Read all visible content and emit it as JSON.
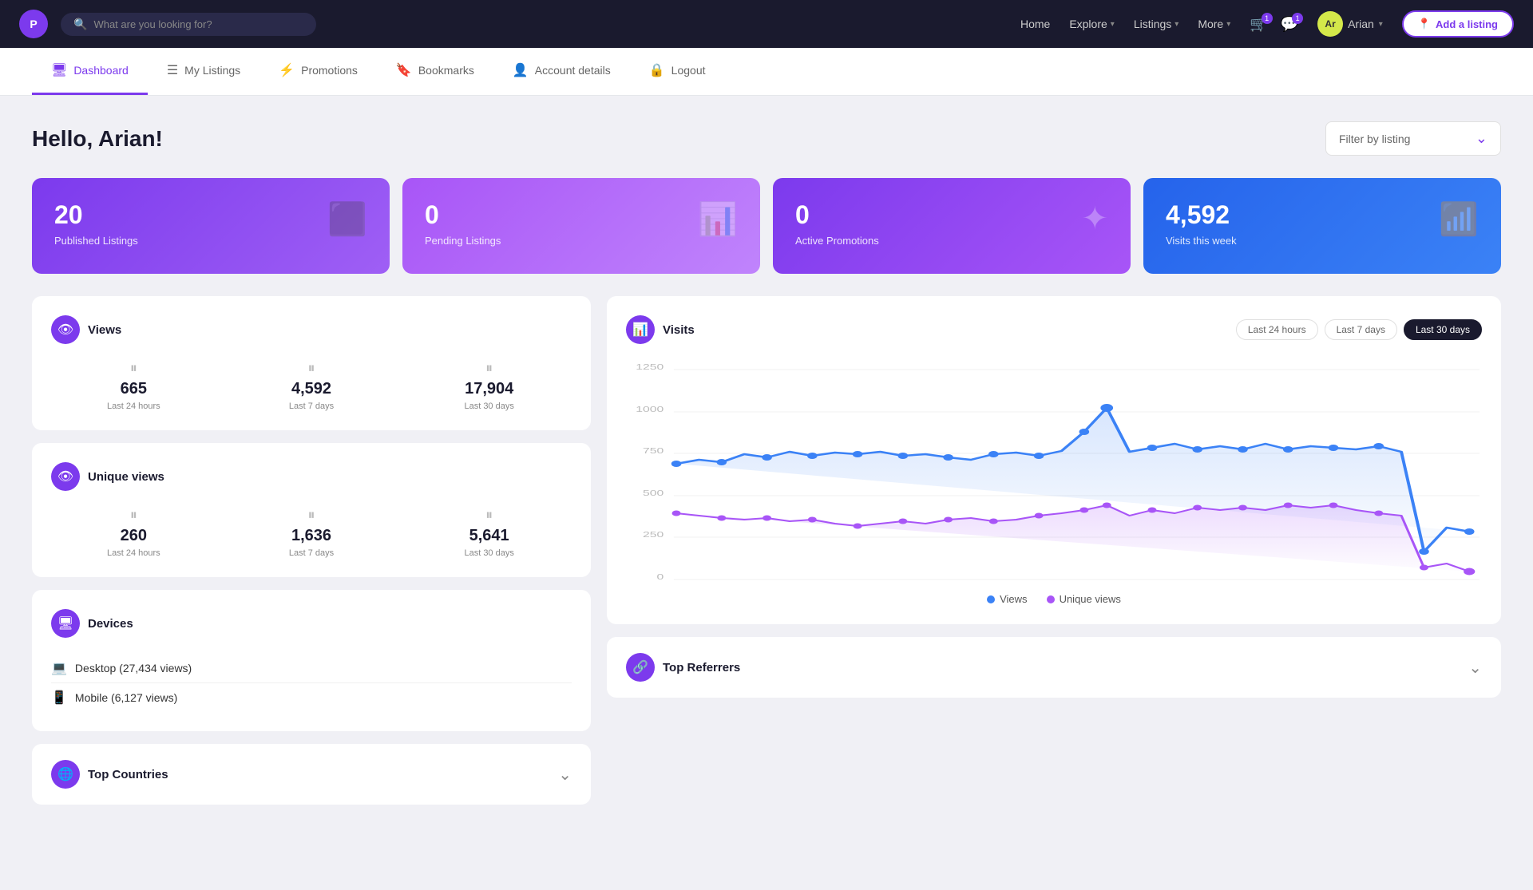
{
  "nav": {
    "logo": "P",
    "search_placeholder": "What are you looking for?",
    "links": [
      {
        "label": "Home",
        "has_dropdown": false
      },
      {
        "label": "Explore",
        "has_dropdown": true
      },
      {
        "label": "Listings",
        "has_dropdown": true
      },
      {
        "label": "More",
        "has_dropdown": true
      }
    ],
    "user": {
      "name": "Arian",
      "initials": "Ar"
    },
    "add_listing": "Add a listing"
  },
  "secondary_nav": {
    "items": [
      {
        "label": "Dashboard",
        "icon": "🖥",
        "active": true
      },
      {
        "label": "My Listings",
        "icon": "≡",
        "active": false
      },
      {
        "label": "Promotions",
        "icon": "⚡",
        "active": false
      },
      {
        "label": "Bookmarks",
        "icon": "🔖",
        "active": false
      },
      {
        "label": "Account details",
        "icon": "👤",
        "active": false
      },
      {
        "label": "Logout",
        "icon": "🔒",
        "active": false
      }
    ]
  },
  "page": {
    "greeting": "Hello, Arian!",
    "filter_label": "Filter by listing"
  },
  "stat_cards": [
    {
      "number": "20",
      "label": "Published Listings"
    },
    {
      "number": "0",
      "label": "Pending Listings"
    },
    {
      "number": "0",
      "label": "Active Promotions"
    },
    {
      "number": "4,592",
      "label": "Visits this week"
    }
  ],
  "views_panel": {
    "title": "Views",
    "stats": [
      {
        "value": "665",
        "label": "Last 24 hours"
      },
      {
        "value": "4,592",
        "label": "Last 7 days"
      },
      {
        "value": "17,904",
        "label": "Last 30 days"
      }
    ]
  },
  "unique_views_panel": {
    "title": "Unique views",
    "stats": [
      {
        "value": "260",
        "label": "Last 24 hours"
      },
      {
        "value": "1,636",
        "label": "Last 7 days"
      },
      {
        "value": "5,641",
        "label": "Last 30 days"
      }
    ]
  },
  "devices_panel": {
    "title": "Devices",
    "items": [
      {
        "icon": "💻",
        "label": "Desktop (27,434 views)"
      },
      {
        "icon": "📱",
        "label": "Mobile (6,127 views)"
      }
    ]
  },
  "countries_panel": {
    "title": "Top Countries"
  },
  "chart": {
    "title": "Visits",
    "time_filters": [
      "Last 24 hours",
      "Last 7 days",
      "Last 30 days"
    ],
    "active_filter": "Last 30 days",
    "y_labels": [
      "0",
      "250",
      "500",
      "750",
      "1000",
      "1250"
    ],
    "legend": [
      {
        "label": "Views",
        "color": "#3b82f6"
      },
      {
        "label": "Unique views",
        "color": "#a855f7"
      }
    ]
  },
  "referrers": {
    "title": "Top Referrers"
  }
}
